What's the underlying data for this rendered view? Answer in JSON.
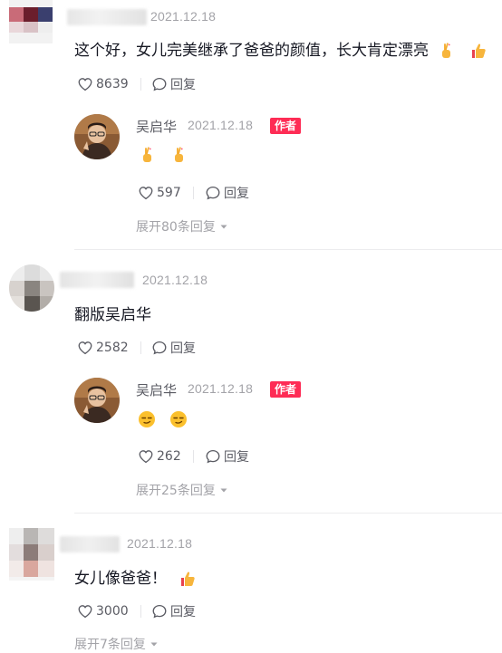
{
  "comments": [
    {
      "date": "2021.12.18",
      "text": "这个好，女儿完美继承了爸爸的颜值，长大肯定漂亮",
      "emoji_icons": [
        "crossed-fingers-heart-icon",
        "thumbs-up-icon"
      ],
      "likes": "8639",
      "reply_label": "回复",
      "author_reply": {
        "name": "吴启华",
        "date": "2021.12.18",
        "tag": "作者",
        "emoji_icons": [
          "crossed-fingers-heart-icon",
          "crossed-fingers-heart-icon"
        ],
        "likes": "597",
        "reply_label": "回复"
      },
      "expand_label": "展开80条回复"
    },
    {
      "date": "2021.12.18",
      "text": "翻版吴启华",
      "likes": "2582",
      "reply_label": "回复",
      "author_reply": {
        "name": "吴启华",
        "date": "2021.12.18",
        "tag": "作者",
        "emoji_icons": [
          "smug-face-icon",
          "smug-face-icon"
        ],
        "likes": "262",
        "reply_label": "回复"
      },
      "expand_label": "展开25条回复"
    },
    {
      "date": "2021.12.18",
      "text": "女儿像爸爸！",
      "emoji_icons": [
        "thumbs-up-icon"
      ],
      "likes": "3000",
      "reply_label": "回复",
      "expand_label": "展开7条回复"
    }
  ],
  "colors": {
    "author_tag": "#fe2c55",
    "secondary_text": "#5a5b63",
    "muted_text": "#a3a3a8"
  }
}
